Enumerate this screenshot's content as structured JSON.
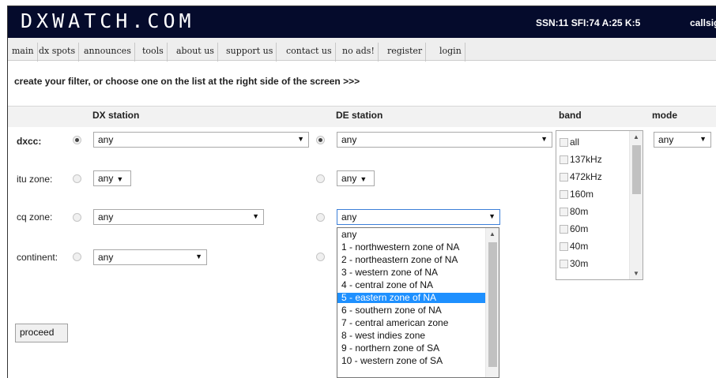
{
  "header": {
    "logo": "DXWATCH.COM",
    "stats": "SSN:11 SFI:74 A:25 K:5",
    "callsign_label": "callsign"
  },
  "nav": [
    "main",
    "dx spots",
    "announces",
    "tools",
    "about us",
    "support us",
    "contact us",
    "no ads!",
    "register",
    "login"
  ],
  "headline": "create your filter, or choose one on the list at the right side of the screen >>>",
  "columns": {
    "dx_station": "DX station",
    "de_station": "DE station",
    "band": "band",
    "mode": "mode"
  },
  "rows": {
    "dxcc": "dxcc:",
    "itu": "itu zone:",
    "cq": "cq zone:",
    "continent": "continent:"
  },
  "values": {
    "dx_dxcc": "any",
    "dx_itu": "any",
    "dx_cq": "any",
    "dx_continent": "any",
    "de_dxcc": "any",
    "de_itu": "any",
    "de_cq": "any",
    "mode": "any"
  },
  "radios": {
    "dx_dxcc_selected": true,
    "de_dxcc_selected": true
  },
  "bands": [
    "all",
    "137kHz",
    "472kHz",
    "160m",
    "80m",
    "60m",
    "40m",
    "30m"
  ],
  "cq_options": [
    "any",
    "1 - northwestern zone of NA",
    "2 - northeastern zone of NA",
    "3 - western zone of NA",
    "4 - central zone of NA",
    "5 - eastern zone of NA",
    "6 - southern zone of NA",
    "7 - central american zone",
    "8 - west indies zone",
    "9 - northern zone of SA",
    "10 - western zone of SA"
  ],
  "cq_highlighted": "5 - eastern zone of NA",
  "proceed_label": "proceed",
  "colors": {
    "topbar": "#050b2c",
    "highlight": "#1e90ff"
  }
}
